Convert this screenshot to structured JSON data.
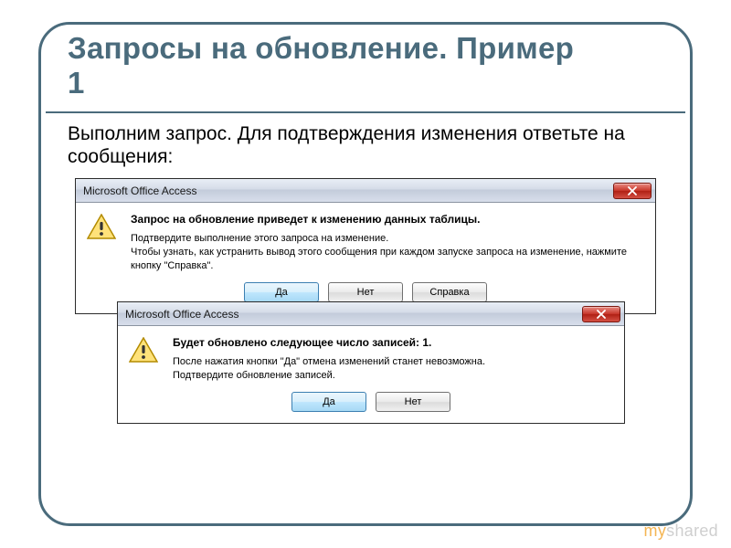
{
  "slide": {
    "title": "Запросы на обновление. Пример 1",
    "body": "Выполним запрос. Для подтверждения изменения ответьте на сообщения:"
  },
  "dialog1": {
    "app_title": "Microsoft Office Access",
    "heading": "Запрос на обновление приведет к изменению данных таблицы.",
    "line1": "Подтвердите выполнение этого запроса на изменение.",
    "line2": "Чтобы узнать, как устранить вывод этого сообщения при каждом запуске запроса на изменение, нажмите кнопку \"Справка\".",
    "btn_yes": "Да",
    "btn_no": "Нет",
    "btn_help": "Справка"
  },
  "dialog2": {
    "app_title": "Microsoft Office Access",
    "heading": "Будет обновлено следующее число записей: 1.",
    "line1": "После нажатия кнопки \"Да\" отмена изменений станет невозможна.",
    "line2": "Подтвердите обновление записей.",
    "btn_yes": "Да",
    "btn_no": "Нет"
  },
  "watermark": {
    "pre": "my",
    "rest": "shared"
  }
}
